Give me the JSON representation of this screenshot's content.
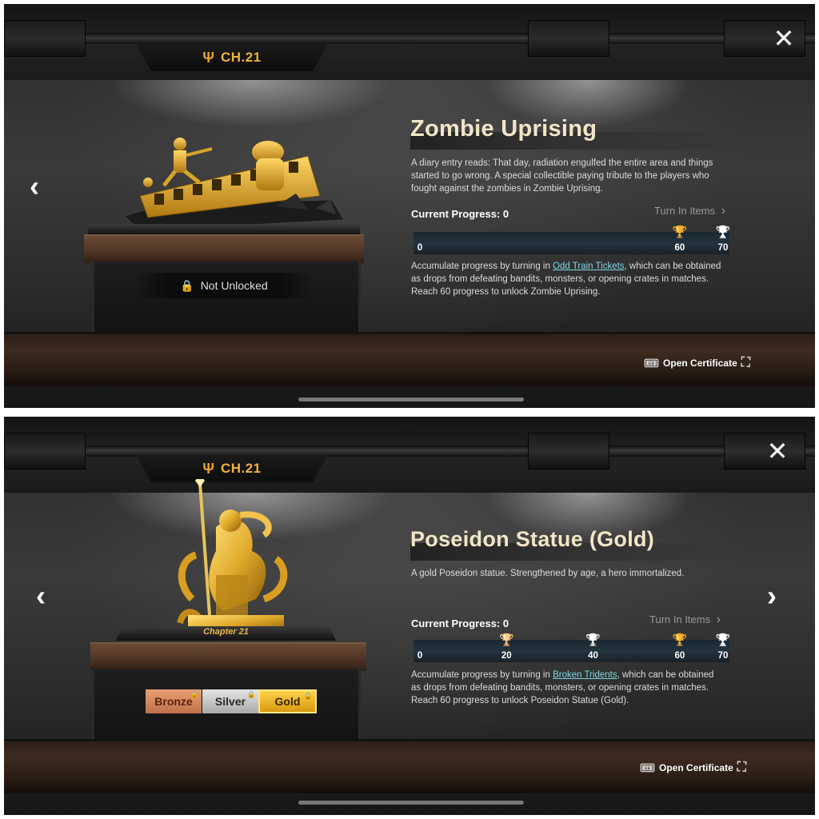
{
  "colors": {
    "gold": "#f0b43a",
    "link": "#7fd8e6",
    "bronze": "#d48a5a",
    "silver": "#cfcfcf"
  },
  "panel1": {
    "chapter": "CH.21",
    "title": "Zombie Uprising",
    "description": "A diary entry reads: That day, radiation engulfed the entire area and things started to go wrong. A special collectible paying tribute to the players who fought against the zombies in Zombie Uprising.",
    "progress_label": "Current Progress: 0",
    "progress_value": 0,
    "turn_in": "Turn In Items",
    "ticks": [
      {
        "label": "0",
        "icon": ""
      },
      {
        "label": "60",
        "icon": "gold-trophy-icon"
      },
      {
        "label": "70",
        "icon": "white-trophy-icon"
      }
    ],
    "accum_prefix": "Accumulate progress by turning in ",
    "accum_item": "Odd Train Tickets",
    "accum_suffix": ", which can be obtained as drops from defeating bandits, monsters, or opening crates in matches. Reach 60 progress to unlock Zombie Uprising.",
    "status": "Not Unlocked",
    "open_certificate": "Open Certificate"
  },
  "panel2": {
    "chapter": "CH.21",
    "title": "Poseidon Statue (Gold)",
    "description": "A gold Poseidon statue. Strengthened by age, a hero immortalized.",
    "progress_label": "Current Progress: 0",
    "progress_value": 0,
    "turn_in": "Turn In Items",
    "ticks": [
      {
        "label": "0",
        "icon": ""
      },
      {
        "label": "20",
        "icon": "bronze-trophy-icon"
      },
      {
        "label": "40",
        "icon": "silver-trophy-icon"
      },
      {
        "label": "60",
        "icon": "gold-trophy-icon"
      },
      {
        "label": "70",
        "icon": "white-trophy-icon"
      }
    ],
    "accum_prefix": "Accumulate progress by turning in ",
    "accum_item": "Broken Tridents",
    "accum_suffix": ", which can be obtained as drops from defeating bandits, monsters, or opening crates in matches. Reach 60 progress to unlock Poseidon Statue (Gold).",
    "plaque": "Chapter 21",
    "tiers": [
      {
        "label": "Bronze",
        "selected": false
      },
      {
        "label": "Silver",
        "selected": false
      },
      {
        "label": "Gold",
        "selected": true
      }
    ],
    "open_certificate": "Open Certificate"
  }
}
